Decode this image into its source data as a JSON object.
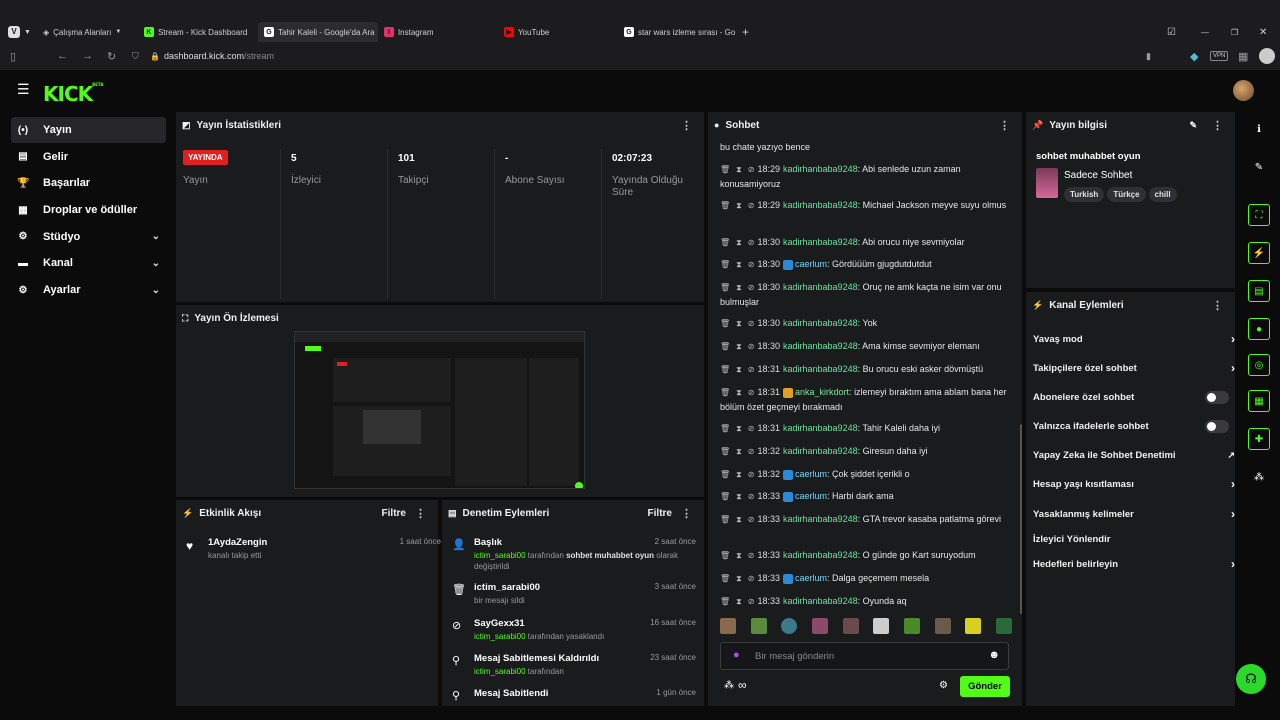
{
  "browser": {
    "workspaces": "Çalışma Alanları",
    "tabs": [
      {
        "label": "Stream - Kick Dashboard",
        "fav": "K",
        "color": "#53fc18"
      },
      {
        "label": "Tahir Kaleli - Google'da Ara",
        "fav": "G",
        "color": "#ffffff"
      },
      {
        "label": "Instagram",
        "fav": "I",
        "color": "#e1306c"
      },
      {
        "label": "YouTube",
        "fav": "▶",
        "color": "#ff0000"
      },
      {
        "label": "star wars izleme sırası - Go",
        "fav": "G",
        "color": "#ffffff"
      }
    ],
    "url_host": "dashboard.kick.com",
    "url_path": "/stream"
  },
  "logo": {
    "text": "KICK",
    "beta": "BETA"
  },
  "nav": [
    {
      "label": "Yayın",
      "icon": "(•)",
      "active": true
    },
    {
      "label": "Gelir",
      "icon": "▤"
    },
    {
      "label": "Başarılar",
      "icon": "🏆"
    },
    {
      "label": "Droplar ve ödüller",
      "icon": "▦"
    },
    {
      "label": "Stüdyo",
      "icon": "⚙",
      "chevron": true
    },
    {
      "label": "Kanal",
      "icon": "▬",
      "chevron": true
    },
    {
      "label": "Ayarlar",
      "icon": "⚙",
      "chevron": true
    }
  ],
  "stats": {
    "title": "Yayın İstatistikleri",
    "live_badge": "YAYINDA",
    "live_label": "Yayın",
    "viewers": "5",
    "viewers_label": "İzleyici",
    "followers": "101",
    "followers_label": "Takipçi",
    "subs": "-",
    "subs_label": "Abone Sayısı",
    "uptime": "02:07:23",
    "uptime_label": "Yayında Olduğu Süre"
  },
  "preview": {
    "title": "Yayın Ön İzlemesi"
  },
  "activity": {
    "title": "Etkinlik Akışı",
    "filter": "Filtre",
    "items": [
      {
        "user": "1AydaZengin",
        "action": "kanalı takip etti",
        "time": "1 saat önce"
      }
    ]
  },
  "mod": {
    "title": "Denetim Eylemleri",
    "filter": "Filtre",
    "items": [
      {
        "title": "Başlık",
        "time": "2 saat önce",
        "actor": "ictim_sarabi00",
        "mid": " tarafından ",
        "bold": "sohbet muhabbet oyun",
        "tail": " olarak değiştirildi",
        "icon": "👤"
      },
      {
        "title": "ictim_sarabi00",
        "time": "3 saat önce",
        "plain": "bir mesajı sildi",
        "icon": "🗑"
      },
      {
        "title": "SayGexx31",
        "time": "16 saat önce",
        "actor": "ictim_sarabi00",
        "mid": " tarafından yasaklandı",
        "icon": "⊘"
      },
      {
        "title": "Mesaj Sabitlemesi Kaldırıldı",
        "time": "23 saat önce",
        "actor": "ictim_sarabi00",
        "mid": " tarafından",
        "icon": "⚲"
      },
      {
        "title": "Mesaj Sabitlendi",
        "time": "1 gün önce",
        "icon": "⚲"
      }
    ]
  },
  "chat": {
    "title": "Sohbet",
    "first_line": "bu chate yazıyo bence",
    "messages": [
      {
        "time": "18:29",
        "user": "kadirhanbaba9248",
        "text": "Abi senlede uzun zaman konusamiyoruz"
      },
      {
        "time": "18:29",
        "user": "kadirhanbaba9248",
        "text": "Michael Jackson meyve suyu olmus"
      },
      {
        "time": "18:30",
        "user": "kadirhanbaba9248",
        "text": "Abi orucu niye sevmiyolar"
      },
      {
        "time": "18:30",
        "user": "caerlum",
        "text": "Gördüüüm gjugdutdutdut",
        "style": "blue"
      },
      {
        "time": "18:30",
        "user": "kadirhanbaba9248",
        "text": "Oruç ne amk kaçta ne isim var onu bulmuşlar"
      },
      {
        "time": "18:30",
        "user": "kadirhanbaba9248",
        "text": "Yok"
      },
      {
        "time": "18:30",
        "user": "kadirhanbaba9248",
        "text": "Ama kimse sevmiyor elemanı"
      },
      {
        "time": "18:31",
        "user": "kadirhanbaba9248",
        "text": "Bu orucu eski asker dövmüştü"
      },
      {
        "time": "18:31",
        "user": "anka_kirkdort",
        "text": "izlemeyi bıraktım ama ablam bana her bölüm özet geçmeyi bırakmadı",
        "style": "gold"
      },
      {
        "time": "18:31",
        "user": "kadirhanbaba9248",
        "text": "Tahir Kaleli daha iyi"
      },
      {
        "time": "18:32",
        "user": "kadirhanbaba9248",
        "text": "Giresun daha iyi"
      },
      {
        "time": "18:32",
        "user": "caerlum",
        "text": "Çok şiddet içerikli o",
        "style": "blue"
      },
      {
        "time": "18:33",
        "user": "caerlum",
        "text": "Harbi dark ama",
        "style": "blue"
      },
      {
        "time": "18:33",
        "user": "kadirhanbaba9248",
        "text": "GTA trevor kasaba patlatma görevi"
      },
      {
        "time": "18:33",
        "user": "kadirhanbaba9248",
        "text": "O günde go Kart suruyodum"
      },
      {
        "time": "18:33",
        "user": "caerlum",
        "text": "Dalga geçemem mesela",
        "style": "blue"
      },
      {
        "time": "18:33",
        "user": "kadirhanbaba9248",
        "text": "Oyunda aq"
      }
    ],
    "input_placeholder": "Bir mesaj gönderin",
    "send": "Gönder"
  },
  "info": {
    "title": "Yayın bilgisi",
    "stream_title": "sohbet muhabbet oyun",
    "category": "Sadece Sohbet",
    "tags": [
      "Turkish",
      "Türkçe",
      "chill"
    ]
  },
  "channel_actions": {
    "title": "Kanal Eylemleri",
    "items": [
      {
        "label": "Yavaş mod",
        "type": "chevron"
      },
      {
        "label": "Takipçilere özel sohbet",
        "type": "chevron"
      },
      {
        "label": "Abonelere özel sohbet",
        "type": "toggle"
      },
      {
        "label": "Yalnızca ifadelerle sohbet",
        "type": "toggle"
      },
      {
        "label": "Yapay Zeka ile Sohbet Denetimi",
        "type": "external"
      },
      {
        "label": "Hesap yaşı kısıtlaması",
        "type": "chevron"
      },
      {
        "label": "Yasaklanmış kelimeler",
        "type": "chevron"
      },
      {
        "label": "İzleyici Yönlendir",
        "type": "none"
      },
      {
        "label": "Hedefleri belirleyin",
        "type": "chevron"
      }
    ]
  },
  "colors": {
    "brand": "#53fc18",
    "live": "#e02020",
    "panel": "#191b1c"
  }
}
